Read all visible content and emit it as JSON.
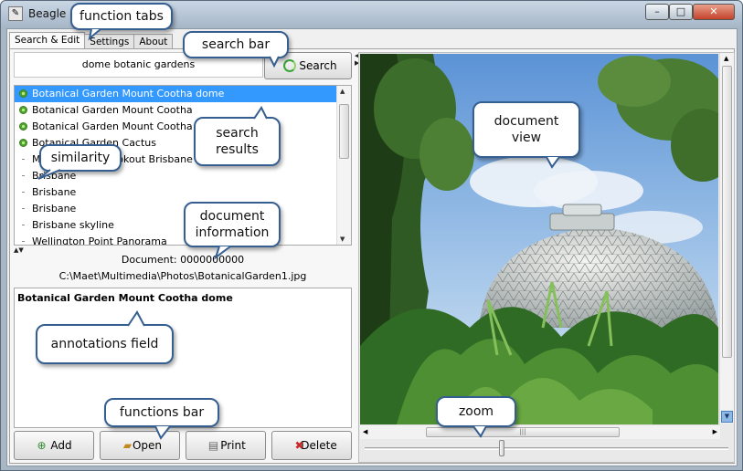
{
  "window": {
    "title": "Beagle",
    "min_glyph": "–",
    "max_glyph": "□",
    "close_glyph": "✕"
  },
  "tabs": [
    {
      "label": "Search & Edit",
      "active": true
    },
    {
      "label": "Settings",
      "active": false
    },
    {
      "label": "About",
      "active": false
    }
  ],
  "search": {
    "value": "dome botanic gardens",
    "button_label": "Search"
  },
  "results": [
    {
      "label": "Botanical Garden Mount Cootha dome",
      "marker": "dot",
      "selected": true
    },
    {
      "label": "Botanical Garden Mount Cootha",
      "marker": "dot",
      "selected": false
    },
    {
      "label": "Botanical Garden Mount Cootha Chair",
      "marker": "dot",
      "selected": false
    },
    {
      "label": "Botanical Garden Cactus",
      "marker": "dot",
      "selected": false
    },
    {
      "label": "Mount Cootha Lookout Brisbane",
      "marker": "dash",
      "selected": false
    },
    {
      "label": "Brisbane",
      "marker": "dash",
      "selected": false
    },
    {
      "label": "Brisbane",
      "marker": "dash",
      "selected": false
    },
    {
      "label": "Brisbane",
      "marker": "dash",
      "selected": false
    },
    {
      "label": "Brisbane skyline",
      "marker": "dash",
      "selected": false
    },
    {
      "label": "Wellington Point Panorama",
      "marker": "dash",
      "selected": false
    }
  ],
  "document": {
    "number_text": "Document: 0000000000",
    "path": "C:\\Maet\\Multimedia\\Photos\\BotanicalGarden1.jpg"
  },
  "annotation": {
    "text": "Botanical Garden Mount Cootha dome"
  },
  "functions": {
    "add_label": "Add",
    "open_label": "Open",
    "print_label": "Print",
    "delete_label": "Delete"
  },
  "viewer": {
    "zoom_level": 0.37
  },
  "callouts": {
    "function_tabs": "function tabs",
    "search_bar": "search bar",
    "search_results_1": "search",
    "search_results_2": "results",
    "similarity": "similarity",
    "document_information_1": "document",
    "document_information_2": "information",
    "document_view_1": "document",
    "document_view_2": "view",
    "annotations_field": "annotations field",
    "functions_bar": "functions bar",
    "zoom": "zoom"
  },
  "colors": {
    "selection": "#3399ff",
    "callout_border": "#365f91",
    "similarity_dot": "#4fa42d"
  }
}
